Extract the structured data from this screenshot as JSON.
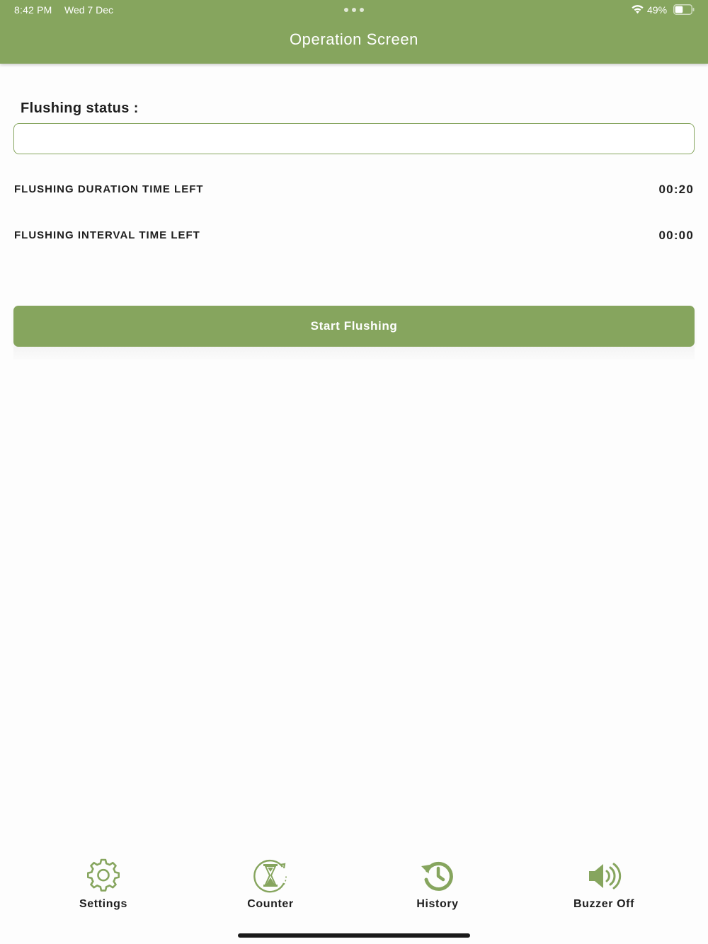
{
  "status_bar": {
    "time": "8:42 PM",
    "date": "Wed 7 Dec",
    "battery": "49%",
    "battery_level": 0.49,
    "icons": [
      "wifi-icon",
      "battery-icon"
    ]
  },
  "header": {
    "title": "Operation Screen",
    "color": "#86a55e"
  },
  "flushing": {
    "status_label": "Flushing status :",
    "status_value": "",
    "duration_label": "FLUSHING DURATION TIME LEFT",
    "duration_value": "00:20",
    "interval_label": "FLUSHING INTERVAL TIME LEFT",
    "interval_value": "00:00",
    "start_button_label": "Start Flushing"
  },
  "bottom_nav": {
    "items": [
      {
        "label": "Settings",
        "icon": "gear-icon"
      },
      {
        "label": "Counter",
        "icon": "hourglass-icon"
      },
      {
        "label": "History",
        "icon": "history-icon"
      },
      {
        "label": "Buzzer Off",
        "icon": "speaker-icon"
      }
    ]
  },
  "colors": {
    "accent": "#86a55e",
    "background": "#fdfdfd",
    "text": "#1e1e1e"
  }
}
